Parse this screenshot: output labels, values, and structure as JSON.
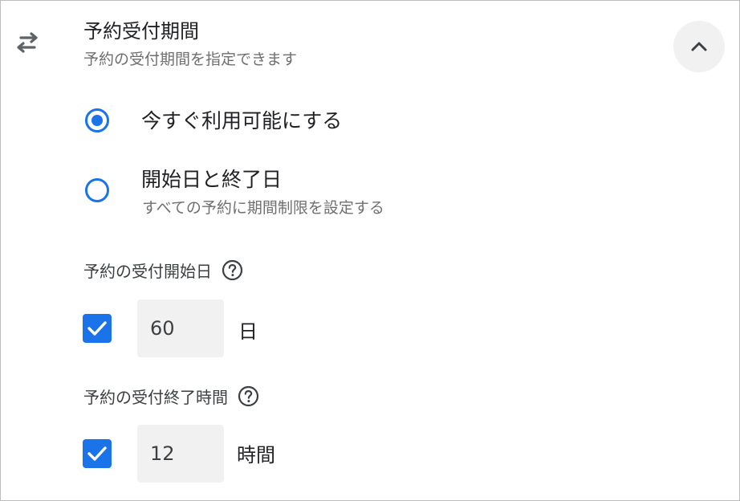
{
  "header": {
    "title": "予約受付期間",
    "subtitle": "予約の受付期間を指定できます",
    "icon": "swap-horiz-icon",
    "collapse_icon": "chevron-up-icon"
  },
  "options": [
    {
      "label": "今すぐ利用可能にする",
      "description": "",
      "selected": true
    },
    {
      "label": "開始日と終了日",
      "description": "すべての予約に期間制限を設定する",
      "selected": false
    }
  ],
  "start": {
    "label": "予約の受付開始日",
    "checked": true,
    "value": "60",
    "unit": "日"
  },
  "end": {
    "label": "予約の受付終了時間",
    "checked": true,
    "value": "12",
    "unit": "時間"
  },
  "colors": {
    "accent": "#1a73e8",
    "muted_text": "#6f6f6f",
    "field_bg": "#f1f1f1"
  }
}
